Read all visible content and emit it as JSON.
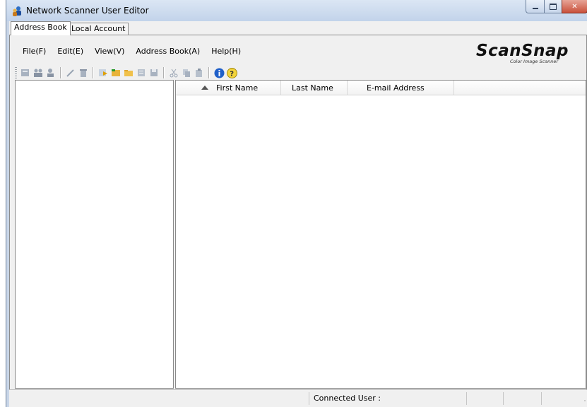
{
  "window": {
    "title": "Network Scanner User Editor"
  },
  "tabs": [
    {
      "label": "Address Book"
    },
    {
      "label": "Local Account"
    }
  ],
  "menu": [
    {
      "label": "File(F)"
    },
    {
      "label": "Edit(E)"
    },
    {
      "label": "View(V)"
    },
    {
      "label": "Address Book(A)"
    },
    {
      "label": "Help(H)"
    }
  ],
  "logo": {
    "brand": "ScanSnap",
    "tagline": "Color Image Scanner"
  },
  "toolbar": {
    "icons": [
      "new-user-icon",
      "new-group-icon",
      "add-member-icon",
      "edit-icon",
      "delete-icon",
      "import-icon",
      "open-folder-icon",
      "folder-icon",
      "list-icon",
      "save-icon",
      "cut-icon",
      "copy-icon",
      "paste-icon",
      "info-icon",
      "help-icon"
    ]
  },
  "table": {
    "columns": [
      {
        "label": "First Name",
        "sorted": "ascending"
      },
      {
        "label": "Last Name"
      },
      {
        "label": "E-mail Address"
      }
    ],
    "rows": []
  },
  "status": {
    "connected_user_label": "Connected User :"
  },
  "colors": {
    "titlebar": "#c2d3ea",
    "close_button": "#c9503b",
    "panel": "#f0f0f0"
  }
}
